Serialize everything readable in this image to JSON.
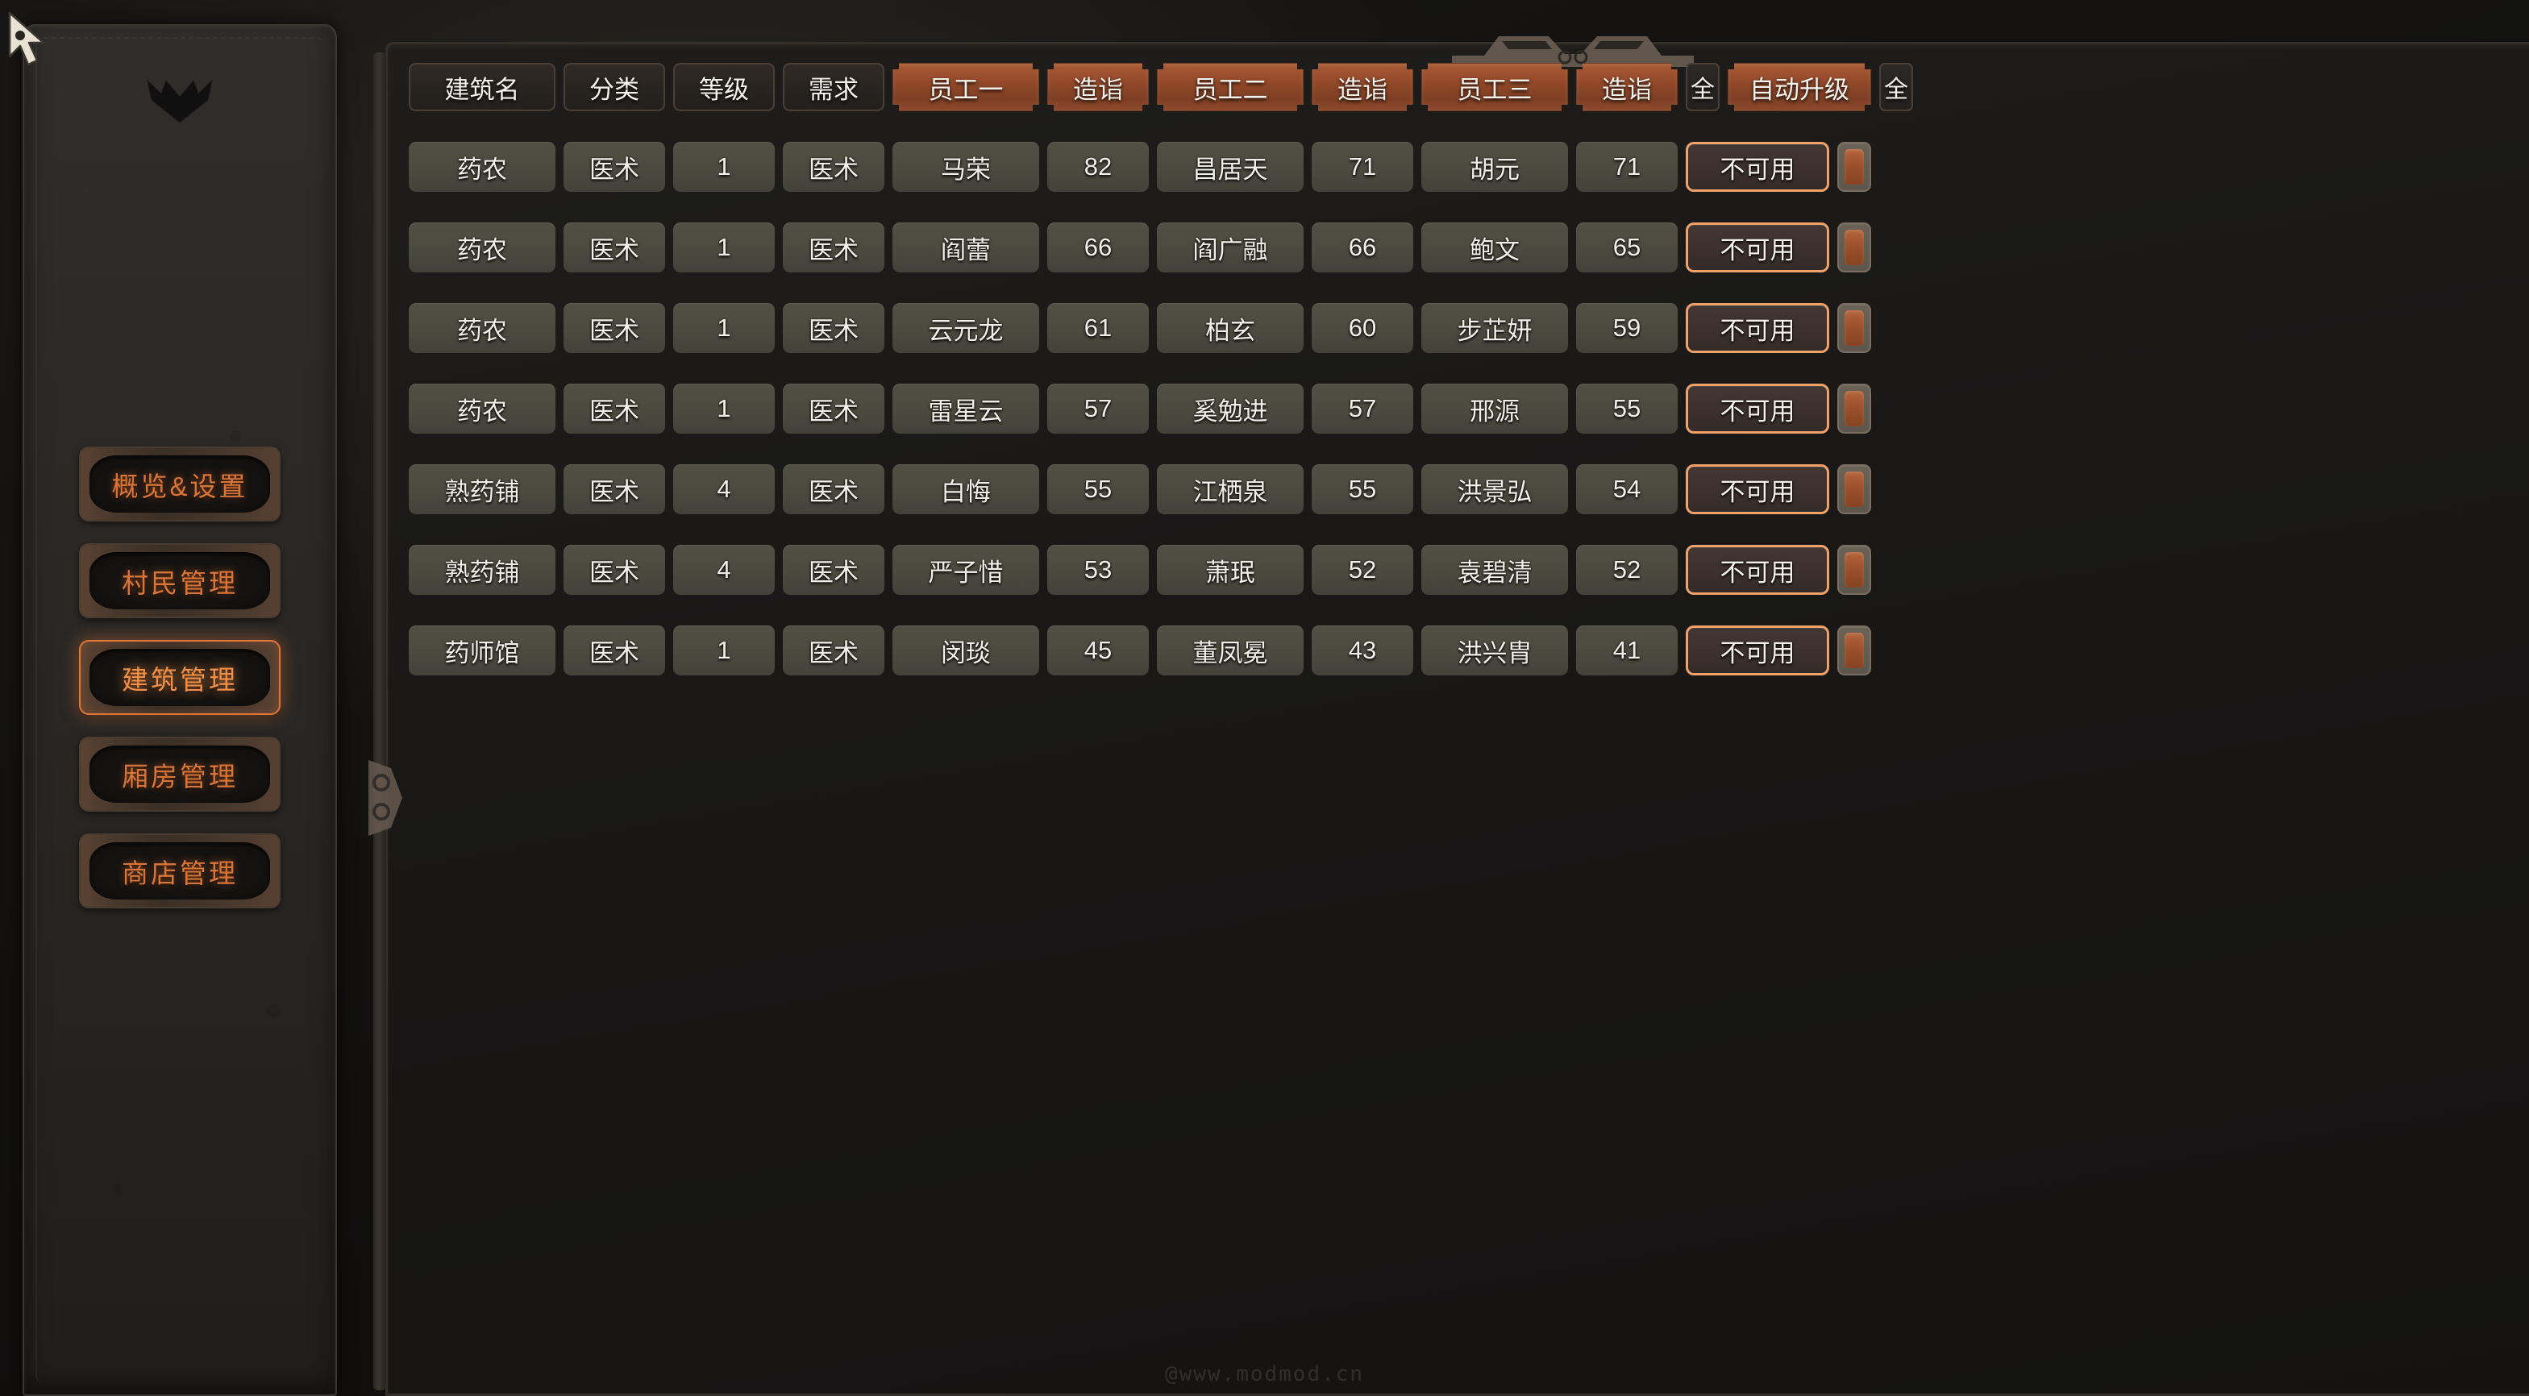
{
  "sidebar": {
    "crest_icon": "crown-crest-icon",
    "items": [
      {
        "label": "概览&设置",
        "active": false
      },
      {
        "label": "村民管理",
        "active": false
      },
      {
        "label": "建筑管理",
        "active": true
      },
      {
        "label": "厢房管理",
        "active": false
      },
      {
        "label": "商店管理",
        "active": false
      }
    ]
  },
  "table": {
    "headers": [
      {
        "label": "建筑名",
        "style": "plain",
        "col": "c-name"
      },
      {
        "label": "分类",
        "style": "plain",
        "col": "c-cat"
      },
      {
        "label": "等级",
        "style": "plain",
        "col": "c-level"
      },
      {
        "label": "需求",
        "style": "plain",
        "col": "c-need"
      },
      {
        "label": "员工一",
        "style": "accent",
        "col": "c-emp"
      },
      {
        "label": "造诣",
        "style": "accent",
        "col": "c-score"
      },
      {
        "label": "员工二",
        "style": "accent",
        "col": "c-emp"
      },
      {
        "label": "造诣",
        "style": "accent",
        "col": "c-score"
      },
      {
        "label": "员工三",
        "style": "accent",
        "col": "c-emp"
      },
      {
        "label": "造诣",
        "style": "accent",
        "col": "c-score"
      },
      {
        "label": "全",
        "style": "tiny",
        "col": "c-all"
      },
      {
        "label": "自动升级",
        "style": "accent",
        "col": "c-auto"
      },
      {
        "label": "全",
        "style": "tiny",
        "col": "c-all"
      }
    ],
    "rows": [
      {
        "name": "药农",
        "category": "医术",
        "level": "1",
        "need": "医术",
        "emp1": "马荣",
        "score1": "82",
        "emp2": "昌居天",
        "score2": "71",
        "emp3": "胡元",
        "score3": "71",
        "status": "不可用",
        "toggle": "on"
      },
      {
        "name": "药农",
        "category": "医术",
        "level": "1",
        "need": "医术",
        "emp1": "阎蕾",
        "score1": "66",
        "emp2": "阎广融",
        "score2": "66",
        "emp3": "鲍文",
        "score3": "65",
        "status": "不可用",
        "toggle": "on"
      },
      {
        "name": "药农",
        "category": "医术",
        "level": "1",
        "need": "医术",
        "emp1": "云元龙",
        "score1": "61",
        "emp2": "柏玄",
        "score2": "60",
        "emp3": "步芷妍",
        "score3": "59",
        "status": "不可用",
        "toggle": "on"
      },
      {
        "name": "药农",
        "category": "医术",
        "level": "1",
        "need": "医术",
        "emp1": "雷星云",
        "score1": "57",
        "emp2": "奚勉进",
        "score2": "57",
        "emp3": "邢源",
        "score3": "55",
        "status": "不可用",
        "toggle": "on"
      },
      {
        "name": "熟药铺",
        "category": "医术",
        "level": "4",
        "need": "医术",
        "emp1": "白悔",
        "score1": "55",
        "emp2": "江栖泉",
        "score2": "55",
        "emp3": "洪景弘",
        "score3": "54",
        "status": "不可用",
        "toggle": "on"
      },
      {
        "name": "熟药铺",
        "category": "医术",
        "level": "4",
        "need": "医术",
        "emp1": "严子惜",
        "score1": "53",
        "emp2": "萧珉",
        "score2": "52",
        "emp3": "袁碧清",
        "score3": "52",
        "status": "不可用",
        "toggle": "on"
      },
      {
        "name": "药师馆",
        "category": "医术",
        "level": "1",
        "need": "医术",
        "emp1": "闵琰",
        "score1": "45",
        "emp2": "董凤冕",
        "score2": "43",
        "emp3": "洪兴胄",
        "score3": "41",
        "status": "不可用",
        "toggle": "on"
      }
    ]
  },
  "watermark": {
    "text": "@www.modmod.cn"
  },
  "cursor": {
    "icon": "mouse-pointer-icon"
  },
  "colors": {
    "accent_orange": "#d8763a",
    "header_accent": "#93492a",
    "status_border": "#f0a268",
    "cell_bg": "#4a4a3f",
    "panel_bg": "#191817"
  }
}
